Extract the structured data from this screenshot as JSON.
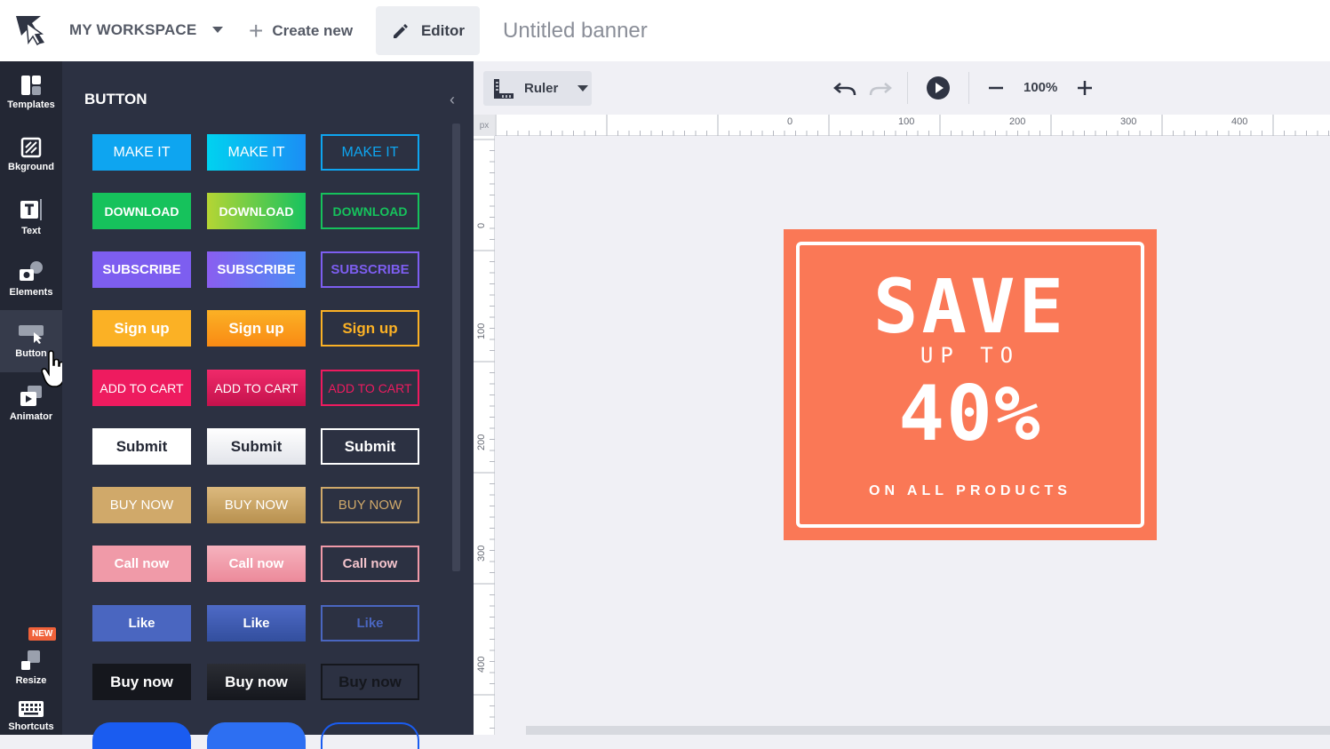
{
  "topbar": {
    "workspace": "MY WORKSPACE",
    "create_new": "Create new",
    "editor": "Editor",
    "title": "Untitled banner"
  },
  "iconbar": {
    "items": [
      {
        "label": "Templates",
        "icon": "templates-icon"
      },
      {
        "label": "Bkground",
        "icon": "background-icon"
      },
      {
        "label": "Text",
        "icon": "text-icon"
      },
      {
        "label": "Elements",
        "icon": "elements-icon"
      },
      {
        "label": "Button",
        "icon": "button-icon"
      },
      {
        "label": "Animator",
        "icon": "animator-icon"
      },
      {
        "label": "Resize",
        "icon": "resize-icon"
      },
      {
        "label": "Shortcuts",
        "icon": "keyboard-icon"
      }
    ],
    "new_badge": "NEW"
  },
  "panel": {
    "title": "BUTTON",
    "rows": [
      {
        "label": "MAKE IT"
      },
      {
        "label": "DOWNLOAD"
      },
      {
        "label": "SUBSCRIBE"
      },
      {
        "label": "Sign up"
      },
      {
        "label": "ADD TO CART"
      },
      {
        "label": "Submit"
      },
      {
        "label": "BUY NOW"
      },
      {
        "label": "Call now"
      },
      {
        "label": "Like"
      },
      {
        "label": "Buy now"
      }
    ]
  },
  "toolbar": {
    "ruler": "Ruler",
    "zoom": "100%"
  },
  "ruler": {
    "unit": "px",
    "h_labels": [
      "0",
      "100",
      "200",
      "300",
      "400"
    ],
    "v_labels": [
      "0",
      "100",
      "200",
      "300",
      "400"
    ]
  },
  "banner": {
    "save": "SAVE",
    "upto": "UP TO",
    "percent": "40%",
    "products": "ON ALL PRODUCTS",
    "bg_color": "#fa7856"
  },
  "colors": {
    "accent": "#fa7856",
    "sidebar": "#232734",
    "panel": "#2c3142"
  }
}
